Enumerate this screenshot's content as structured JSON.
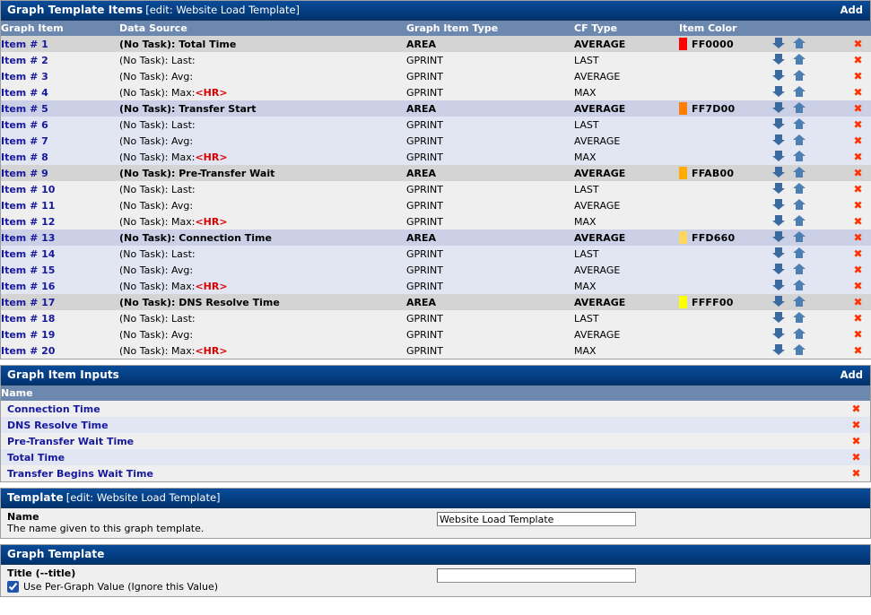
{
  "graph_template_items": {
    "title": "Graph Template Items",
    "subtitle": "[edit: Website Load Template]",
    "add_label": "Add",
    "columns": {
      "graph_item": "Graph Item",
      "data_source": "Data Source",
      "graph_item_type": "Graph Item Type",
      "cf_type": "CF Type",
      "item_color": "Item Color"
    },
    "icons": {
      "move_down": "arrow-down-icon",
      "move_up": "arrow-up-icon",
      "delete": "delete-icon",
      "delete_glyph": "✖"
    },
    "rows": [
      {
        "item": "Item # 1",
        "ds_text": "(No Task): Total Time",
        "ds_hr": "",
        "type": "AREA",
        "cf": "AVERAGE",
        "color": "FF0000",
        "color_hex": "#FF0000",
        "group": "a",
        "head": true
      },
      {
        "item": "Item # 2",
        "ds_text": "(No Task): Last:",
        "ds_hr": "",
        "type": "GPRINT",
        "cf": "LAST",
        "color": "",
        "color_hex": "",
        "group": "a",
        "head": false
      },
      {
        "item": "Item # 3",
        "ds_text": "(No Task): Avg:",
        "ds_hr": "",
        "type": "GPRINT",
        "cf": "AVERAGE",
        "color": "",
        "color_hex": "",
        "group": "a",
        "head": false
      },
      {
        "item": "Item # 4",
        "ds_text": "(No Task): Max:",
        "ds_hr": "<HR>",
        "type": "GPRINT",
        "cf": "MAX",
        "color": "",
        "color_hex": "",
        "group": "a",
        "head": false
      },
      {
        "item": "Item # 5",
        "ds_text": "(No Task): Transfer Start",
        "ds_hr": "",
        "type": "AREA",
        "cf": "AVERAGE",
        "color": "FF7D00",
        "color_hex": "#FF7D00",
        "group": "b",
        "head": true
      },
      {
        "item": "Item # 6",
        "ds_text": "(No Task): Last:",
        "ds_hr": "",
        "type": "GPRINT",
        "cf": "LAST",
        "color": "",
        "color_hex": "",
        "group": "b",
        "head": false
      },
      {
        "item": "Item # 7",
        "ds_text": "(No Task): Avg:",
        "ds_hr": "",
        "type": "GPRINT",
        "cf": "AVERAGE",
        "color": "",
        "color_hex": "",
        "group": "b",
        "head": false
      },
      {
        "item": "Item # 8",
        "ds_text": "(No Task): Max:",
        "ds_hr": "<HR>",
        "type": "GPRINT",
        "cf": "MAX",
        "color": "",
        "color_hex": "",
        "group": "b",
        "head": false
      },
      {
        "item": "Item # 9",
        "ds_text": "(No Task): Pre-Transfer Wait",
        "ds_hr": "",
        "type": "AREA",
        "cf": "AVERAGE",
        "color": "FFAB00",
        "color_hex": "#FFAB00",
        "group": "a",
        "head": true
      },
      {
        "item": "Item # 10",
        "ds_text": "(No Task): Last:",
        "ds_hr": "",
        "type": "GPRINT",
        "cf": "LAST",
        "color": "",
        "color_hex": "",
        "group": "a",
        "head": false
      },
      {
        "item": "Item # 11",
        "ds_text": "(No Task): Avg:",
        "ds_hr": "",
        "type": "GPRINT",
        "cf": "AVERAGE",
        "color": "",
        "color_hex": "",
        "group": "a",
        "head": false
      },
      {
        "item": "Item # 12",
        "ds_text": "(No Task): Max:",
        "ds_hr": "<HR>",
        "type": "GPRINT",
        "cf": "MAX",
        "color": "",
        "color_hex": "",
        "group": "a",
        "head": false
      },
      {
        "item": "Item # 13",
        "ds_text": "(No Task): Connection Time",
        "ds_hr": "",
        "type": "AREA",
        "cf": "AVERAGE",
        "color": "FFD660",
        "color_hex": "#FFD660",
        "group": "b",
        "head": true
      },
      {
        "item": "Item # 14",
        "ds_text": "(No Task): Last:",
        "ds_hr": "",
        "type": "GPRINT",
        "cf": "LAST",
        "color": "",
        "color_hex": "",
        "group": "b",
        "head": false
      },
      {
        "item": "Item # 15",
        "ds_text": "(No Task): Avg:",
        "ds_hr": "",
        "type": "GPRINT",
        "cf": "AVERAGE",
        "color": "",
        "color_hex": "",
        "group": "b",
        "head": false
      },
      {
        "item": "Item # 16",
        "ds_text": "(No Task): Max:",
        "ds_hr": "<HR>",
        "type": "GPRINT",
        "cf": "MAX",
        "color": "",
        "color_hex": "",
        "group": "b",
        "head": false
      },
      {
        "item": "Item # 17",
        "ds_text": "(No Task): DNS Resolve Time",
        "ds_hr": "",
        "type": "AREA",
        "cf": "AVERAGE",
        "color": "FFFF00",
        "color_hex": "#FFFF00",
        "group": "a",
        "head": true
      },
      {
        "item": "Item # 18",
        "ds_text": "(No Task): Last:",
        "ds_hr": "",
        "type": "GPRINT",
        "cf": "LAST",
        "color": "",
        "color_hex": "",
        "group": "a",
        "head": false
      },
      {
        "item": "Item # 19",
        "ds_text": "(No Task): Avg:",
        "ds_hr": "",
        "type": "GPRINT",
        "cf": "AVERAGE",
        "color": "",
        "color_hex": "",
        "group": "a",
        "head": false
      },
      {
        "item": "Item # 20",
        "ds_text": "(No Task): Max:",
        "ds_hr": "<HR>",
        "type": "GPRINT",
        "cf": "MAX",
        "color": "",
        "color_hex": "",
        "group": "a",
        "head": false
      }
    ]
  },
  "graph_item_inputs": {
    "title": "Graph Item Inputs",
    "add_label": "Add",
    "columns": {
      "name": "Name"
    },
    "rows": [
      {
        "name": "Connection Time"
      },
      {
        "name": "DNS Resolve Time"
      },
      {
        "name": "Pre-Transfer Wait Time"
      },
      {
        "name": "Total Time"
      },
      {
        "name": "Transfer Begins Wait Time"
      }
    ]
  },
  "template": {
    "title": "Template",
    "subtitle": "[edit: Website Load Template]",
    "name_label": "Name",
    "name_desc": "The name given to this graph template.",
    "name_value": "Website Load Template",
    "name_placeholder": ""
  },
  "graph_template": {
    "title": "Graph Template",
    "title_label": "Title (--title)",
    "per_graph_label": "Use Per-Graph Value (Ignore this Value)",
    "per_graph_checked": true,
    "title_value": "",
    "title_placeholder": ""
  },
  "colors": {
    "titlebar": "#00438C",
    "column_header": "#6D88AE",
    "row_group_a_head": "#D4D4D4",
    "row_group_a_sub": "#EFEFEF",
    "row_group_b_head": "#CBD0E6",
    "row_group_b_sub": "#E2E6F3",
    "link": "#16199C",
    "hr_tag": "#E00000",
    "delete": "#FF3300",
    "arrow_down": "#3A6A9E",
    "arrow_up": "#4D7FB3"
  }
}
